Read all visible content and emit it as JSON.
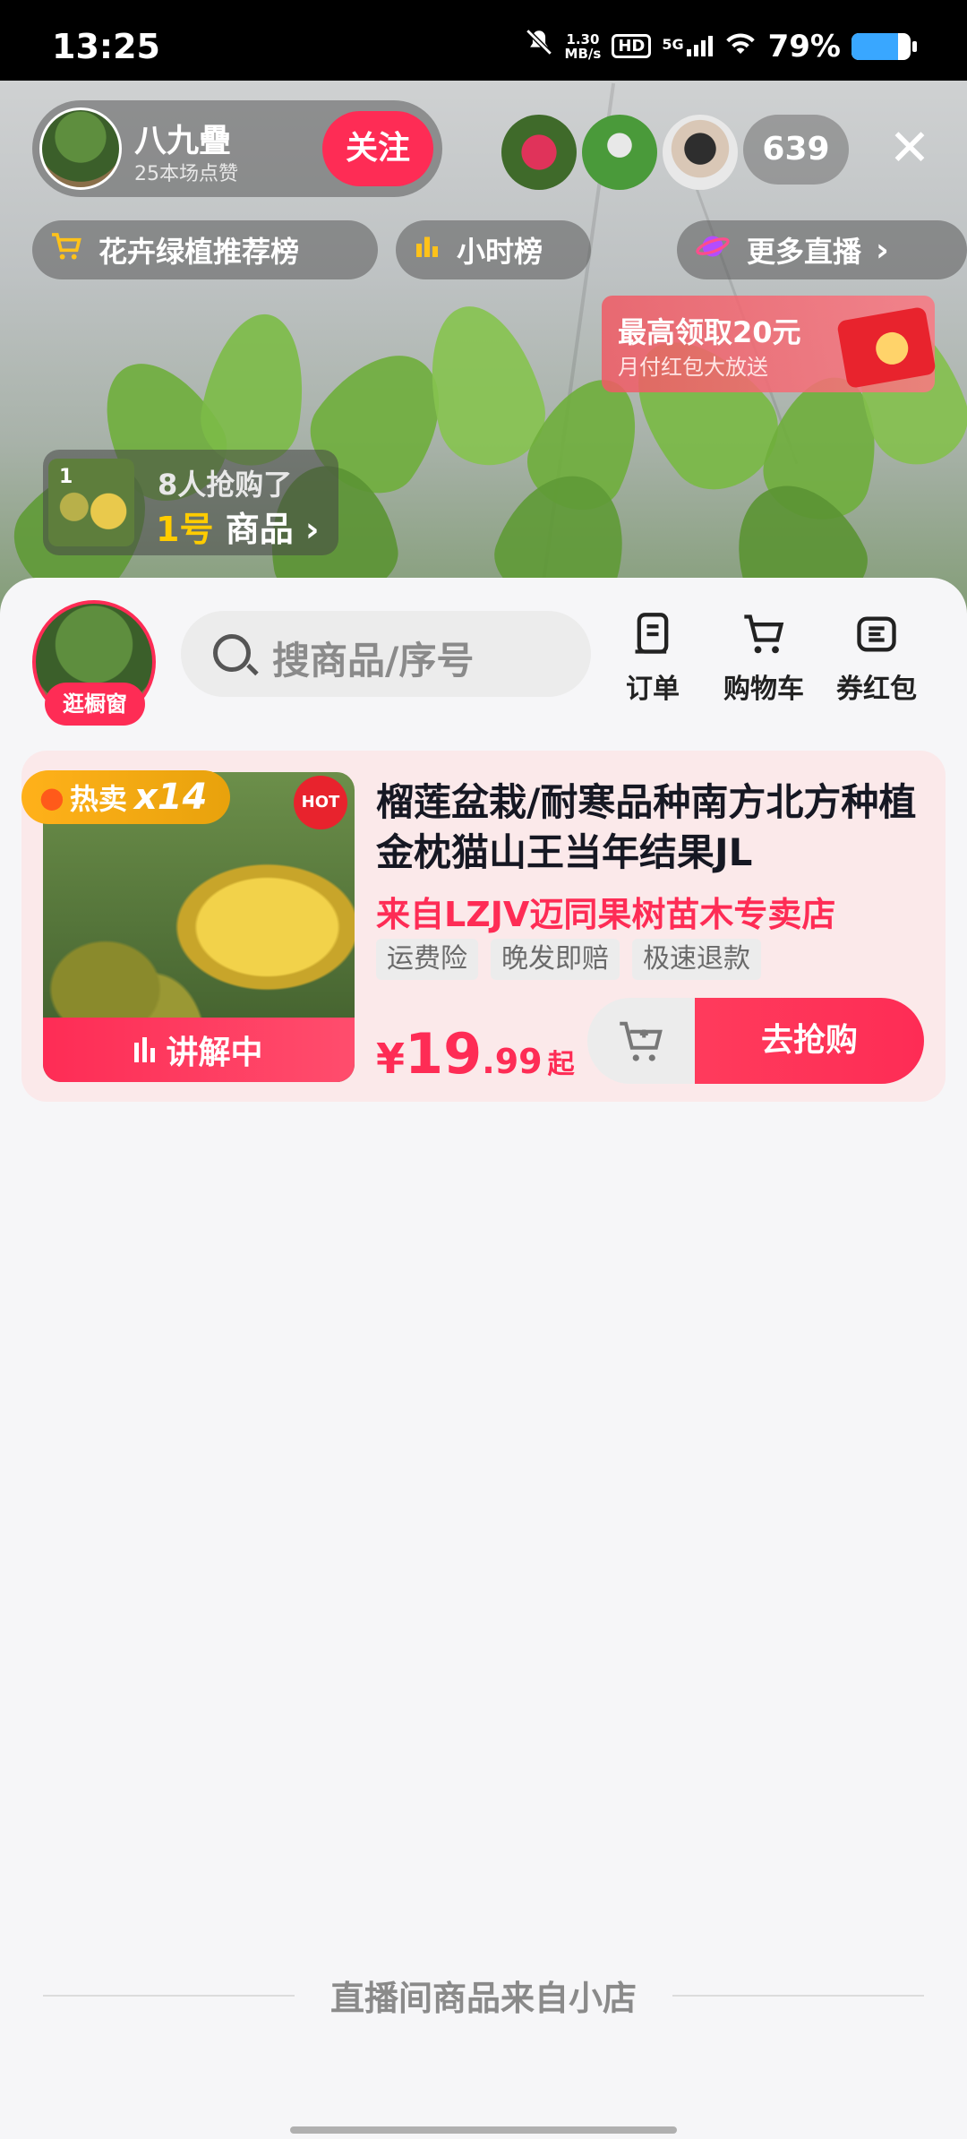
{
  "status": {
    "time": "13:25",
    "net_speed_top": "1.30",
    "net_speed_bottom": "MB/s",
    "hd": "HD",
    "signal": "5G",
    "battery": "79%",
    "battery_level": 0.79
  },
  "live": {
    "host_name": "八九疊",
    "host_likes": "25本场点赞",
    "follow_label": "关注",
    "viewer_count": "639",
    "close_icon": "close-icon",
    "pills": [
      {
        "icon": "cart-icon",
        "label": "花卉绿植推荐榜"
      },
      {
        "icon": "bar-chart-icon",
        "label": "小时榜"
      },
      {
        "icon": "planet-icon",
        "label": "更多直播"
      }
    ],
    "redpacket": {
      "title": "最高领取20元",
      "subtitle": "月付红包大放送"
    },
    "bought": {
      "thumb_num": "1",
      "line1": "8人抢购了",
      "num": "1号",
      "label": "商品"
    }
  },
  "shop": {
    "avatar_tag": "逛橱窗",
    "search_placeholder": "搜商品/序号",
    "tools": [
      {
        "icon": "order-icon",
        "label": "订单"
      },
      {
        "icon": "shopping-cart-icon",
        "label": "购物车"
      },
      {
        "icon": "coupon-icon",
        "label": "券红包"
      }
    ]
  },
  "product": {
    "sell_tag": "热卖",
    "sell_multiplier": "x14",
    "hot_badge": "HOT",
    "explaining": "讲解中",
    "title": "榴莲盆栽/耐寒品种南方北方种植金枕猫山王当年结果JL",
    "shop": "来自LZJV迈同果树苗木专卖店",
    "tags": [
      "运费险",
      "晚发即赔",
      "极速退款"
    ],
    "price_symbol": "¥",
    "price_int": "19",
    "price_dec": ".99",
    "price_suffix": "起",
    "buy_label": "去抢购"
  },
  "footer": {
    "text": "直播间商品来自小店"
  }
}
